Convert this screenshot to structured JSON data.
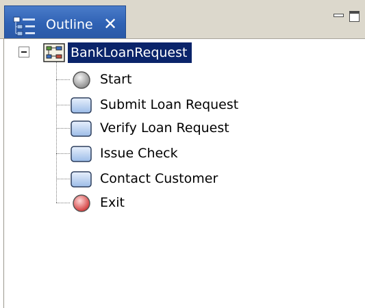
{
  "view": {
    "tab_title": "Outline",
    "close_glyph": "✕",
    "colors": {
      "tab_active": "#2f62b4",
      "selection": "#0a246a",
      "tabstrip": "#dcd8cc"
    }
  },
  "tree": {
    "root": {
      "label": "BankLoanRequest",
      "icon": "process-icon",
      "expanded": true,
      "selected": true
    },
    "children": [
      {
        "label": "Start",
        "icon": "start-event-icon"
      },
      {
        "label": "Submit Loan Request",
        "icon": "task-icon"
      },
      {
        "label": "Verify Loan Request",
        "icon": "task-icon"
      },
      {
        "label": "Issue Check",
        "icon": "task-icon"
      },
      {
        "label": "Contact Customer",
        "icon": "task-icon"
      },
      {
        "label": "Exit",
        "icon": "end-event-icon"
      }
    ]
  }
}
